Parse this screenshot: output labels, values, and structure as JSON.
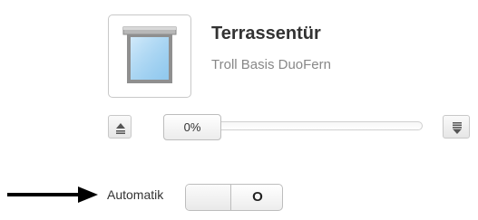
{
  "device": {
    "title": "Terrassentür",
    "subtitle": "Troll Basis DuoFern",
    "icon": "window-shutter-icon"
  },
  "controls": {
    "up_icon": "shutter-up-icon",
    "down_icon": "shutter-down-icon",
    "position_label": "0%",
    "position_percent": 0
  },
  "automatik": {
    "label": "Automatik",
    "toggle_text": "O",
    "state": "off"
  },
  "annotation": {
    "icon": "right-arrow-icon",
    "color": "#000000"
  }
}
